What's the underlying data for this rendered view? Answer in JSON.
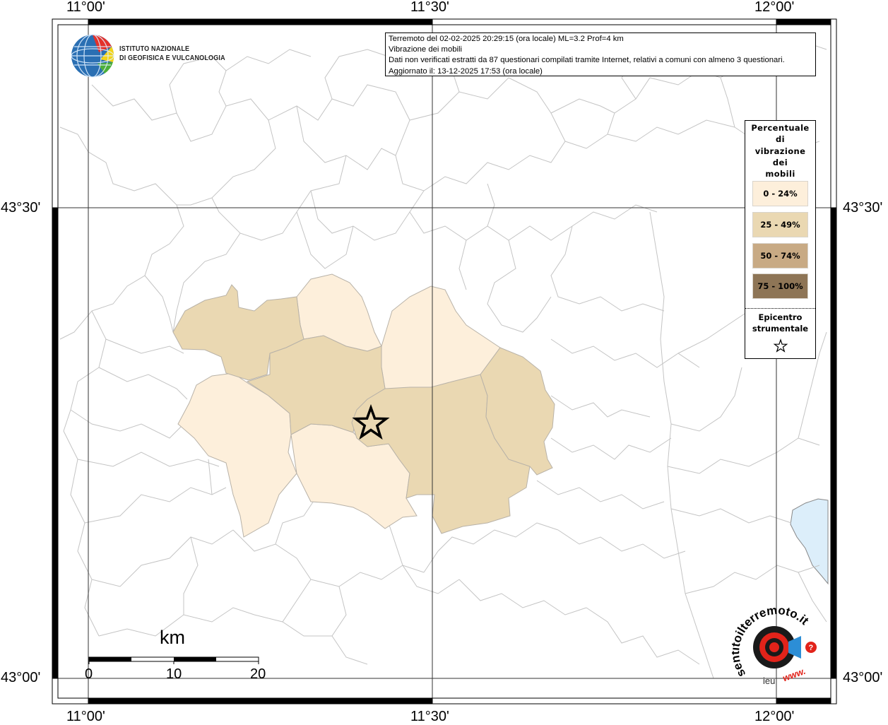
{
  "map": {
    "lon_ticks": [
      "11°00'",
      "11°30'",
      "12°00'"
    ],
    "lat_ticks": [
      "43°30'",
      "43°00'"
    ],
    "tick_labels_bottom": [
      "11°00'",
      "11°30'",
      "12°00'"
    ],
    "tick_labels_top": [
      "11°00'",
      "11°30'",
      "12°00'"
    ],
    "tick_labels_left": [
      "43°30'",
      "43°00'"
    ],
    "tick_labels_right": [
      "43°30'",
      "43°00'"
    ]
  },
  "info": {
    "line1": "Terremoto del 02-02-2025 20:29:15 (ora locale) ML=3.2 Prof=4 km",
    "line2": "Vibrazione dei mobili",
    "line3": "Dati non verificati estratti da 87 questionari compilati tramite Internet, relativi a comuni con almeno 3 questionari.",
    "line4": "Aggiornato il: 13-12-2025 17:53 (ora locale)"
  },
  "logo": {
    "line1": "ISTITUTO NAZIONALE",
    "line2": "DI GEOFISICA E VULCANOLOGIA"
  },
  "legend": {
    "title_lines": [
      "Percentuale",
      "di",
      "vibrazione",
      "dei",
      "mobili"
    ],
    "classes": [
      {
        "label": "0 - 24%",
        "color": "#fdefdb"
      },
      {
        "label": "25 - 49%",
        "color": "#ead8b2"
      },
      {
        "label": "50 - 74%",
        "color": "#c8aa84"
      },
      {
        "label": "75 - 100%",
        "color": "#8e7556"
      }
    ],
    "epicenter_lines": [
      "Epicentro",
      "strumentale"
    ]
  },
  "scale": {
    "unit": "km",
    "ticks": [
      "0",
      "10",
      "20"
    ]
  },
  "brand": {
    "text": "sentitoilterremoto.it",
    "url_text": "www.",
    "suffix": "ieu"
  }
}
